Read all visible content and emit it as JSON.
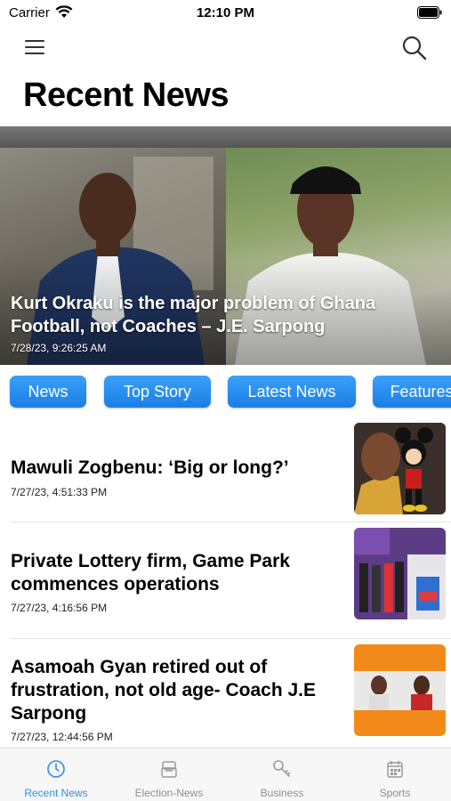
{
  "status_bar": {
    "carrier": "Carrier",
    "time": "12:10 PM"
  },
  "header": {
    "title": "Recent News",
    "menu_icon": "hamburger-menu-icon",
    "search_icon": "search-icon"
  },
  "featured": {
    "title": "Kurt Okraku is the major problem of Ghana Football, not Coaches – J.E. Sarpong",
    "date": "7/28/23, 9:26:25 AM"
  },
  "categories": [
    {
      "label": "News"
    },
    {
      "label": "Top Story"
    },
    {
      "label": "Latest News"
    },
    {
      "label": "Features"
    }
  ],
  "articles": [
    {
      "title": "Mawuli Zogbenu: ‘Big or long?’",
      "date": "7/27/23, 4:51:33 PM"
    },
    {
      "title": "Private Lottery firm, Game Park commences operations",
      "date": "7/27/23, 4:16:56 PM"
    },
    {
      "title": "Asamoah Gyan retired out of frustration, not old age- Coach J.E Sarpong",
      "date": "7/27/23, 12:44:56 PM"
    }
  ],
  "tabs": [
    {
      "label": "Recent News",
      "icon": "clock-icon",
      "active": true
    },
    {
      "label": "Election-News",
      "icon": "ballot-box-icon",
      "active": false
    },
    {
      "label": "Business",
      "icon": "key-icon",
      "active": false
    },
    {
      "label": "Sports",
      "icon": "calendar-icon",
      "active": false
    }
  ],
  "colors": {
    "accent": "#1a86ea",
    "tab_active": "#2f8ee6",
    "tab_inactive": "#8e8e93"
  }
}
